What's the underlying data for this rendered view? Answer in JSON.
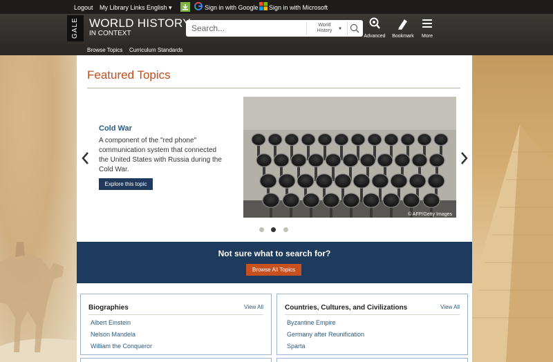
{
  "topbar": {
    "logout": "Logout",
    "my_library": "My Library Links",
    "language": "English",
    "google": "Sign in with Google",
    "microsoft": "Sign in with Microsoft"
  },
  "header": {
    "gale": "GALE",
    "brand_line1": "WORLD HISTORY",
    "brand_line2": "IN CONTEXT",
    "search_placeholder": "Search...",
    "scope_line1": "World",
    "scope_line2": "History",
    "advanced": "Advanced",
    "bookmark": "Bookmark",
    "more": "More"
  },
  "subnav": {
    "browse": "Browse Topics",
    "standards": "Curriculum Standards"
  },
  "featured": {
    "title": "Featured Topics",
    "topic_name": "Cold War",
    "topic_desc": "A component of the \"red phone\" communication system that connected the United States with Russia during the Cold War.",
    "explore": "Explore this topic",
    "credit": "© AFP/Getty Images",
    "active_slide": 2,
    "slide_count": 3
  },
  "cta": {
    "text": "Not sure what to search for?",
    "button": "Browse All Topics"
  },
  "cards": [
    {
      "title": "Biographies",
      "view_all": "View All",
      "items": [
        "Albert Einstein",
        "Nelson Mandela",
        "William the Conqueror"
      ]
    },
    {
      "title": "Countries, Cultures, and Civilizations",
      "view_all": "View All",
      "items": [
        "Byzantine Empire",
        "Germany after Reunification",
        "Sparta"
      ]
    }
  ]
}
